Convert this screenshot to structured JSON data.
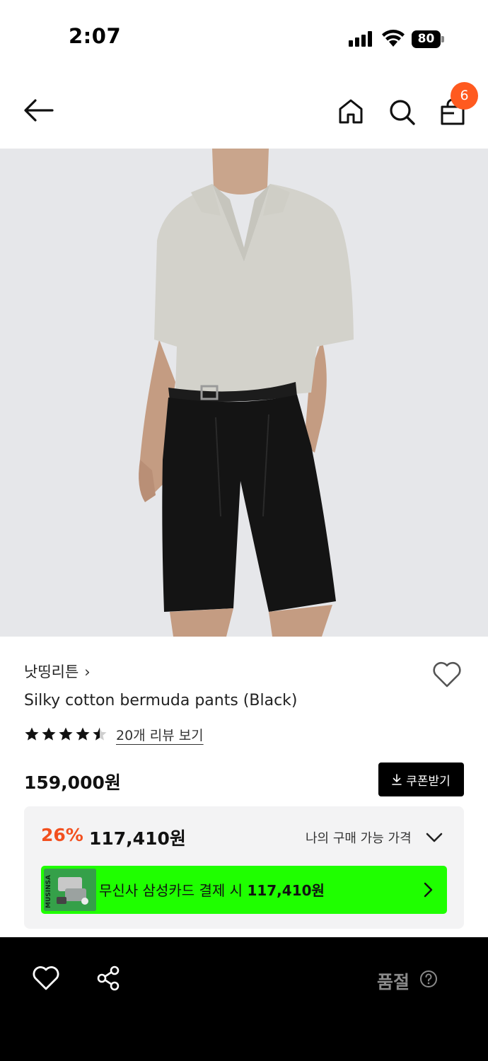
{
  "status_bar": {
    "time": "2:07",
    "battery": "80"
  },
  "nav": {
    "cart_count": "6",
    "icons": [
      "back-arrow-icon",
      "home-icon",
      "search-icon",
      "shopping-bag-icon"
    ]
  },
  "product": {
    "image_alt": "model wearing black bermuda shorts and light knit top",
    "brand": "낫띵리튼",
    "brand_chevron": "›",
    "name": "Silky cotton bermuda pants (Black)",
    "rating": 4.5,
    "review_link": "20개 리뷰 보기",
    "price": "159,000원",
    "coupon_label": "쿠폰받기"
  },
  "price_box": {
    "discount_rate": "26%",
    "discount_price": "117,410원",
    "my_price_label": "나의 구매 가능 가격",
    "card_banner_text_prefix": "무신사 삼성카드 결제 시 ",
    "card_banner_price": "117,410원",
    "card_brand": "MUSINSA"
  },
  "bottom_bar": {
    "soldout_label": "품절"
  },
  "colors": {
    "accent_orange": "#f2501f",
    "badge_orange": "#ff5a1f",
    "banner_green": "#1fff00",
    "bottom_bar": "#000000"
  }
}
